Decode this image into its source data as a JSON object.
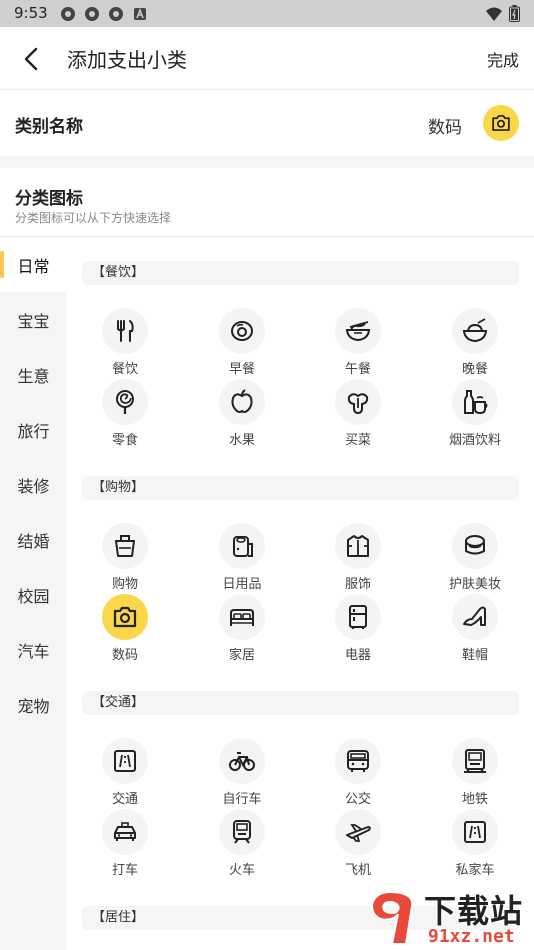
{
  "status_bar": {
    "time": "9:53"
  },
  "header": {
    "title": "添加支出小类",
    "done_label": "完成"
  },
  "category_name": {
    "label": "类别名称",
    "value": "数码",
    "selected_icon": "camera-icon"
  },
  "icon_section": {
    "title": "分类图标",
    "subtitle": "分类图标可以从下方快速选择"
  },
  "left_nav": [
    {
      "label": "日常",
      "active": true
    },
    {
      "label": "宝宝"
    },
    {
      "label": "生意"
    },
    {
      "label": "旅行"
    },
    {
      "label": "装修"
    },
    {
      "label": "结婚"
    },
    {
      "label": "校园"
    },
    {
      "label": "汽车"
    },
    {
      "label": "宠物"
    }
  ],
  "sections": [
    {
      "title": "【餐饮】",
      "items": [
        {
          "label": "餐饮",
          "icon": "fork-knife-icon"
        },
        {
          "label": "早餐",
          "icon": "egg-icon"
        },
        {
          "label": "午餐",
          "icon": "noodle-bowl-icon"
        },
        {
          "label": "晚餐",
          "icon": "rice-bowl-icon"
        },
        {
          "label": "零食",
          "icon": "lollipop-icon"
        },
        {
          "label": "水果",
          "icon": "apple-icon"
        },
        {
          "label": "买菜",
          "icon": "vegetable-icon"
        },
        {
          "label": "烟酒饮料",
          "icon": "bottle-cup-icon"
        }
      ]
    },
    {
      "title": "【购物】",
      "items": [
        {
          "label": "购物",
          "icon": "shopping-bag-icon"
        },
        {
          "label": "日用品",
          "icon": "tissue-roll-icon"
        },
        {
          "label": "服饰",
          "icon": "jacket-icon"
        },
        {
          "label": "护肤美妆",
          "icon": "cosmetics-icon"
        },
        {
          "label": "数码",
          "icon": "camera-icon",
          "selected": true
        },
        {
          "label": "家居",
          "icon": "bed-icon"
        },
        {
          "label": "电器",
          "icon": "fridge-icon"
        },
        {
          "label": "鞋帽",
          "icon": "high-heel-icon"
        }
      ]
    },
    {
      "title": "【交通】",
      "items": [
        {
          "label": "交通",
          "icon": "road-icon"
        },
        {
          "label": "自行车",
          "icon": "bicycle-icon"
        },
        {
          "label": "公交",
          "icon": "bus-icon"
        },
        {
          "label": "地铁",
          "icon": "subway-icon"
        },
        {
          "label": "打车",
          "icon": "taxi-icon"
        },
        {
          "label": "火车",
          "icon": "train-icon"
        },
        {
          "label": "飞机",
          "icon": "airplane-icon"
        },
        {
          "label": "私家车",
          "icon": "private-car-icon"
        }
      ]
    },
    {
      "title": "【居住】",
      "items": []
    }
  ],
  "colors": {
    "accent": "#fad64a",
    "nav_indicator": "#f7c94a",
    "circle_bg": "#f4f4f4",
    "section_bg": "#f5f5f5"
  },
  "watermark": {
    "big": "下载站",
    "small": "91xz.net"
  }
}
